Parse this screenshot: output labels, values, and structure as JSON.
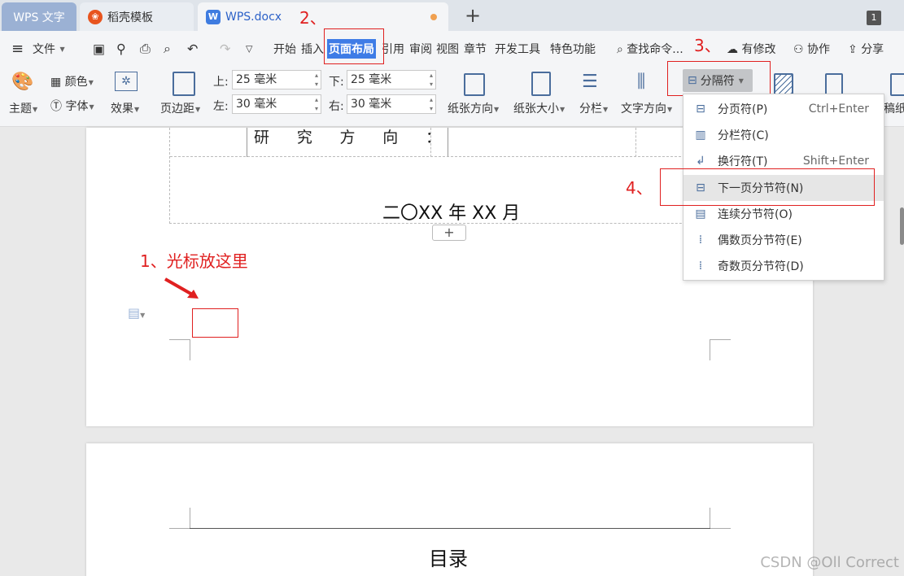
{
  "tabs": {
    "wps": "WPS 文字",
    "daoke": "稻壳模板",
    "doc": "WPS.docx",
    "new_tab": "+",
    "window_count": "1"
  },
  "menu": {
    "file": "文件",
    "items": [
      "开始",
      "插入",
      "页面布局",
      "引用",
      "审阅",
      "视图",
      "章节",
      "开发工具",
      "特色功能"
    ],
    "search": "查找命令...",
    "has_changes": "有修改",
    "collab": "协作",
    "share": "分享"
  },
  "ribbon": {
    "theme": "主题",
    "color": "颜色",
    "font": "字体",
    "effect": "效果",
    "margins": "页边距",
    "top_label": "上:",
    "top_value": "25 毫米",
    "bottom_label": "下:",
    "bottom_value": "25 毫米",
    "left_label": "左:",
    "left_value": "30 毫米",
    "right_label": "右:",
    "right_value": "30 毫米",
    "orientation": "纸张方向",
    "size": "纸张大小",
    "columns": "分栏",
    "text_direction": "文字方向",
    "separator": "分隔符",
    "cut_label": "稿纸"
  },
  "dropdown": {
    "items": [
      {
        "label": "分页符(P)",
        "shortcut": "Ctrl+Enter",
        "icon": "page-break-icon"
      },
      {
        "label": "分栏符(C)",
        "shortcut": "",
        "icon": "column-break-icon"
      },
      {
        "label": "换行符(T)",
        "shortcut": "Shift+Enter",
        "icon": "line-break-icon"
      },
      {
        "label": "下一页分节符(N)",
        "shortcut": "",
        "icon": "next-page-section-icon"
      },
      {
        "label": "连续分节符(O)",
        "shortcut": "",
        "icon": "continuous-section-icon"
      },
      {
        "label": "偶数页分节符(E)",
        "shortcut": "",
        "icon": "even-page-section-icon"
      },
      {
        "label": "奇数页分节符(D)",
        "shortcut": "",
        "icon": "odd-page-section-icon"
      }
    ]
  },
  "document": {
    "research_chars": [
      "研",
      "究",
      "方",
      "向",
      "："
    ],
    "date": "二〇XX 年 XX 月",
    "toc_title": "目录",
    "add_row": "+"
  },
  "annotations": {
    "step1": "1、光标放这里",
    "step2": "2、",
    "step3": "3、",
    "step4": "4、"
  },
  "watermark": "CSDN @Oll Correct",
  "colors": {
    "accent": "#3e7ce6",
    "annotation": "#e02020",
    "active_tab_text": "#2d62c8"
  }
}
